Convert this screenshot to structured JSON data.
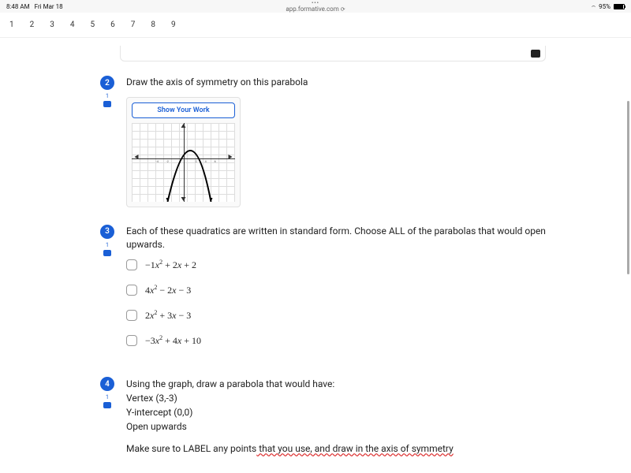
{
  "status": {
    "time": "8:48 AM",
    "date": "Fri Mar 18",
    "url": "app.formative.com",
    "battery_percent": "95%"
  },
  "nav": {
    "items": [
      "1",
      "2",
      "3",
      "4",
      "5",
      "6",
      "7",
      "8",
      "9"
    ]
  },
  "q2": {
    "number": "2",
    "points": "1",
    "prompt": "Draw the axis of symmetry on this parabola",
    "show_work": "Show Your Work"
  },
  "q3": {
    "number": "3",
    "points": "1",
    "prompt": "Each of these quadratics are written in standard form. Choose ALL of the parabolas that would open upwards.",
    "choices": [
      "−1x² + 2x + 2",
      "4x² − 2x − 3",
      "2x² + 3x − 3",
      "−3x² + 4x + 10"
    ]
  },
  "q4": {
    "number": "4",
    "points": "1",
    "line1": "Using the graph, draw a parabola that would have:",
    "line2": "Vertex (3,-3)",
    "line3": "Y-intercept (0,0)",
    "line4": "Open upwards",
    "note_prefix": "Make sure to LABEL any points",
    "note_wavy": " that you use, and draw in the axis of symmetry"
  },
  "chart_data": {
    "type": "line",
    "title": "Parabola on coordinate plane",
    "xlim": [
      -6,
      6
    ],
    "ylim": [
      -6,
      6
    ],
    "x": [
      -2,
      -1,
      0,
      1,
      2,
      3,
      4
    ],
    "y": [
      -6,
      0,
      4,
      5,
      4,
      0,
      -6
    ],
    "shape": "downward-opening parabola, vertex approx (1,5)"
  }
}
